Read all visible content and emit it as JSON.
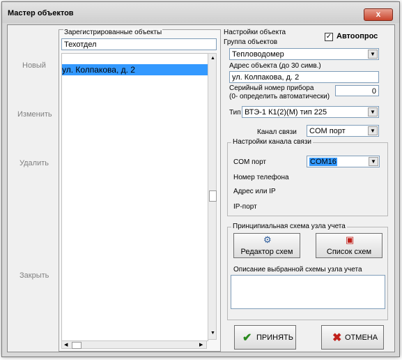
{
  "window": {
    "title": "Мастер объектов",
    "close_label": "x"
  },
  "nav": {
    "new": "Новый",
    "edit": "Изменить",
    "delete": "Удалить",
    "close": "Закрыть"
  },
  "registered": {
    "title": "Зарегистрированные объекты",
    "group": "Техотдел",
    "items": [
      "ул. Колпакова, д. 2"
    ]
  },
  "settings": {
    "title": "Настройки объекта",
    "autopoll_label": "Автоопрос",
    "autopoll_checked": true,
    "group_label": "Группа объектов",
    "group_value": "Тепловодомер",
    "address_label": "Адрес объекта (до 30 симв.)",
    "address_value": "ул. Колпакова, д. 2",
    "serial_label_1": "Серийный номер прибора",
    "serial_label_2": "(0- определить автоматически)",
    "serial_value": "0",
    "type_label": "Тип",
    "type_value": "ВТЭ-1 К1(2)(М) тип 225",
    "channel_label": "Канал связи",
    "channel_value": "COM порт"
  },
  "channel_settings": {
    "title": "Настройки канала связи",
    "com_label": "COM порт",
    "com_value": "COM16",
    "phone_label": "Номер телефона",
    "addr_label": "Адрес или IP",
    "ipport_label": "IP-порт"
  },
  "scheme": {
    "title": "Принципиальная схема узла учета",
    "editor_label": "Редактор схем",
    "list_label": "Список схем",
    "desc_label": "Описание выбранной схемы узла учета"
  },
  "footer": {
    "accept": "ПРИНЯТЬ",
    "cancel": "ОТМЕНА"
  },
  "colors": {
    "selection": "#3399ff",
    "accept_icon": "#2a8a1e",
    "cancel_icon": "#c0201a"
  }
}
